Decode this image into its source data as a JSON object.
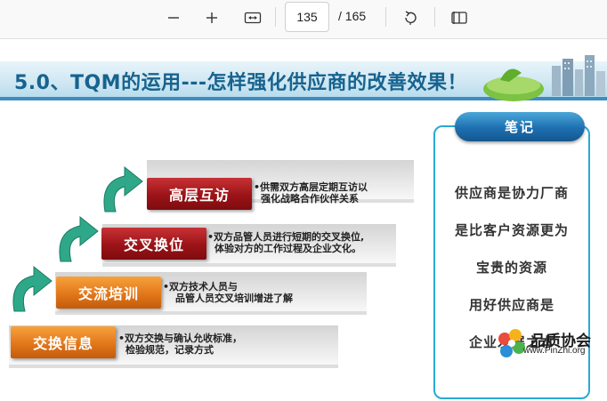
{
  "toolbar": {
    "zoom_out_icon": "minus-icon",
    "zoom_in_icon": "plus-icon",
    "fit_width_icon": "fit-width-icon",
    "current_page": "135",
    "total_pages": "/ 165",
    "rotate_icon": "rotate-icon",
    "two_page_icon": "two-page-view-icon"
  },
  "slide": {
    "title": "5.0、TQM的运用---怎样强化供应商的改善效果！",
    "steps": [
      {
        "label": "高层互访",
        "desc_line1": "•供需双方高层定期互访以",
        "desc_line2": "强化战略合作伙伴关系",
        "color": "#9b1317"
      },
      {
        "label": "交叉换位",
        "desc_line1": "•双方品管人员进行短期的交叉换位,",
        "desc_line2": "体验对方的工作过程及企业文化。",
        "color": "#9b1317"
      },
      {
        "label": "交流培训",
        "desc_line1": "•双方技术人员与",
        "desc_line2": "品管人员交叉培训增进了解",
        "color": "#e2771a"
      },
      {
        "label": "交换信息",
        "desc_line1": "•双方交换与确认允收标准，",
        "desc_line2": "检验规范，记录方式",
        "color": "#e2771a"
      }
    ],
    "notes": {
      "header": "笔记",
      "lines": [
        "供应商是协力厂商",
        "是比客户资源更为",
        "宝贵的资源",
        "用好供应商是",
        "企业发展之本"
      ]
    },
    "watermark": {
      "name": "品质协会",
      "url": "www.PinZhi.org"
    }
  },
  "colors": {
    "title_text": "#17638f",
    "notes_border": "#29a9d4",
    "arrow_green": "#2fa88a"
  }
}
